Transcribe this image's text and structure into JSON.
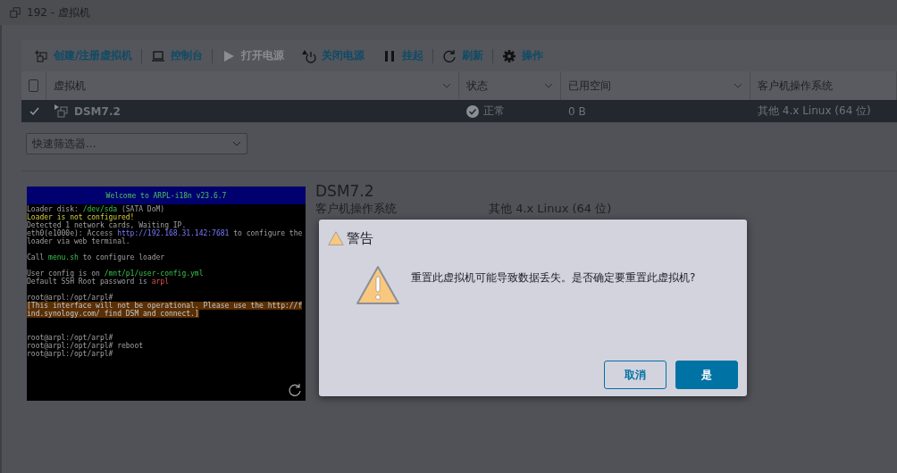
{
  "window": {
    "title": "192 - 虚拟机"
  },
  "toolbar": [
    [
      {
        "label": "创建/注册虚拟机",
        "disabled": false
      }
    ],
    [
      {
        "label": "控制台",
        "disabled": false
      }
    ],
    [
      {
        "label": "打开电源",
        "disabled": true
      },
      {
        "label": "关闭电源",
        "disabled": false
      },
      {
        "label": "挂起",
        "disabled": false
      }
    ],
    [
      {
        "label": "刷新",
        "disabled": false
      }
    ],
    [
      {
        "label": "操作",
        "disabled": false
      }
    ]
  ],
  "table": {
    "all_checked": false,
    "columns": [
      {
        "label": "虚拟机",
        "sortable": true
      },
      {
        "label": "状态",
        "sortable": true
      },
      {
        "label": "已用空间",
        "sortable": true
      },
      {
        "label": "客户机操作系统",
        "sortable": false
      }
    ],
    "rows": [
      {
        "selected": true,
        "name": "DSM7.2",
        "status": "正常",
        "used": "0 B",
        "os": "其他 4.x Linux (64 位)"
      }
    ]
  },
  "filter": {
    "placeholder": "快速筛选器..."
  },
  "details": {
    "title": "DSM7.2",
    "rows": [
      {
        "label": "客户机操作系统",
        "value": "其他 4.x Linux (64 位)"
      }
    ],
    "console": {
      "title": "Welcome to ARPL-i18n v23.6.7",
      "lines": [
        {
          "kind": "text",
          "segments": [
            {
              "kind": "plain",
              "text": "Loader disk: "
            },
            {
              "kind": "path",
              "text": "/dev/sda"
            },
            {
              "kind": "plain",
              "text": " (SATA DoM)"
            }
          ]
        },
        {
          "kind": "text",
          "segments": [
            {
              "kind": "warn",
              "text": "Loader is not configured!"
            }
          ]
        },
        {
          "kind": "text",
          "segments": [
            {
              "kind": "plain",
              "text": "Detected 1 network cards, Waiting IP."
            }
          ]
        },
        {
          "kind": "text",
          "segments": [
            {
              "kind": "plain",
              "text": "eth0(e1000e): Access "
            },
            {
              "kind": "link",
              "text": "http://192.168.31.142:7681"
            },
            {
              "kind": "plain",
              "text": " to configure the loader via web terminal."
            }
          ]
        },
        {
          "kind": "blank"
        },
        {
          "kind": "text",
          "segments": [
            {
              "kind": "plain",
              "text": "Call "
            },
            {
              "kind": "path",
              "text": "menu.sh"
            },
            {
              "kind": "plain",
              "text": " to configure loader"
            }
          ]
        },
        {
          "kind": "blank"
        },
        {
          "kind": "text",
          "segments": [
            {
              "kind": "plain",
              "text": "User config is on "
            },
            {
              "kind": "path",
              "text": "/mnt/p1/user-config.yml"
            }
          ]
        },
        {
          "kind": "text",
          "segments": [
            {
              "kind": "plain",
              "text": "Default SSH Root password is "
            },
            {
              "kind": "error",
              "text": "arpl"
            }
          ]
        },
        {
          "kind": "blank"
        },
        {
          "kind": "text",
          "segments": [
            {
              "kind": "plain",
              "text": "root@arpl:/opt/arpl#"
            }
          ]
        },
        {
          "kind": "text",
          "segments": [
            {
              "kind": "highlight",
              "text": "[This interface will not be operational. Please use the http://find.synology.com/ find DSM and connect.]"
            }
          ]
        },
        {
          "kind": "blank"
        },
        {
          "kind": "blank"
        },
        {
          "kind": "text",
          "segments": [
            {
              "kind": "plain",
              "text": "root@arpl:/opt/arpl#"
            }
          ]
        },
        {
          "kind": "text",
          "segments": [
            {
              "kind": "plain",
              "text": "root@arpl:/opt/arpl# reboot"
            }
          ]
        },
        {
          "kind": "text",
          "segments": [
            {
              "kind": "plain",
              "text": "root@arpl:/opt/arpl#"
            }
          ]
        }
      ]
    }
  },
  "dialog": {
    "title": "警告",
    "message": "重置此虚拟机可能导致数据丢失。是否确定要重置此虚拟机?",
    "buttons": [
      {
        "label": "取消",
        "primary": false
      },
      {
        "label": "是",
        "primary": true
      }
    ]
  }
}
